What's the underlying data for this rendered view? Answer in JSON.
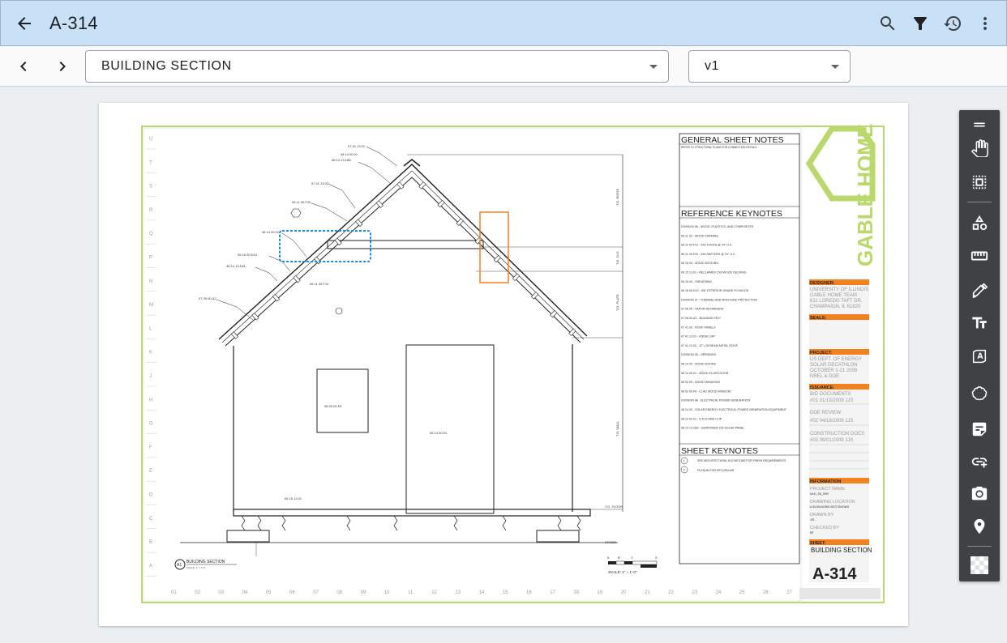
{
  "app": {
    "title": "A-314"
  },
  "toolbar_actions": [
    "search-icon",
    "filter-icon",
    "history-icon",
    "more-vert-icon"
  ],
  "sheet_select": {
    "value": "BUILDING SECTION"
  },
  "version_select": {
    "value": "v1"
  },
  "drawing": {
    "general_notes_title": "GENERAL SHEET NOTES",
    "general_note_1": "REFER TO STRUCTURAL PLANS FOR CONNECTION DETAILS",
    "reference_title": "REFERENCE KEYNOTES",
    "reference_lines": [
      "DIVISION 06 - WOOD, PLASTICS, AND COMPOSITES",
      "06 11 00 - WOOD FRAMING",
      "06 11 00.F13   -   2X6 JOISTS @ 24\" O.C.",
      "06 11 00.F20   -   2X6 RAFTERS @ 24\" O.C.",
      "06 15 00 - WOOD DECKING",
      "06 15 13.01   -   RECLAIMED 2X6 WOOD DECKING",
      "06 16 00 - SHEATHING",
      "06 16 00.D10   -   5/8\" EXTERIOR GRADE PLYWOOD",
      "DIVISION 07 - THERMAL AND MOISTURE PROTECTION",
      "07 26 00 - VAPOR RETARDERS",
      "07 26 00.A2   -   BUILDING FELT",
      "07 41 00 - ROOF PANELS",
      "07 41 13.01   -   RIDGE CAP",
      "07 41 13.02   -   12\" LOKSEAM METAL ROOF",
      "DIVISION 08 - OPENINGS",
      "08 14 00 - WOOD DOORS",
      "08 14 00.01   -   WOOD FLUSH DOOR",
      "08 52 00 - WOOD WINDOWS",
      "08 52 00.F8   -   CLAD WOOD WINDOW",
      "DIVISION 48 - ELECTRICAL POWER GENERATION",
      "48 14 00 - SOLAR ENERGY ELECTRICAL POWER GENERATION EQUIPMENT",
      "48 14 00.01   -   S-5! U-MINI CLIP",
      "48 14 13.16A   -   SUNPOWER 225 SOLAR PANEL"
    ],
    "sheet_keynotes_title": "SHEET KEYNOTES",
    "sheet_keynote_1": "SEE ARCHITECTURAL ELEVATIONS FOR FINISH REQUIREMENTS",
    "sheet_keynote_2": "PLENUM FOR RETURN AIR",
    "logo_text": "GABLE HOME",
    "designer_label": "DESIGNER:",
    "designer_lines": [
      "UNIVERSITY OF ILLINOIS",
      "GABLE HOME TEAM",
      "611 LOREDO TAFT DR.",
      "CHAMPAIGN, IL 61820"
    ],
    "seals_label": "SEALS:",
    "project_label": "PROJECT:",
    "project_lines": [
      "US DEPT. OF ENERGY",
      "SOLAR DECATHLON",
      "OCTOBER 1-21 2009",
      "NREL & DOE"
    ],
    "issuance_label": "ISSUANCE:",
    "issuance_1_title": "BID DOCUMENTS",
    "issuance_1_row": "#01  01/15/2009  JJS",
    "issuance_2_title": "DOE REVIEW",
    "issuance_2_row": "#02  04/16/2009  JJS",
    "issuance_3_title": "CONSTRUCTION DOCS",
    "issuance_3_row": "#03  06/01/2009  JJS",
    "information_label": "INFORMATION",
    "project_name_label": "PROJECT NAME",
    "project_name_value": "UIUC_SD_2009",
    "drawing_location_label": "DRAWING LOCATION",
    "drawing_location_value": "A-314 BUILDING SECTION.DWG",
    "drawn_by_label": "DRAWN BY",
    "drawn_by_value": "JJS",
    "checked_by_label": "CHECKED BY",
    "checked_by_value": "MT",
    "sheet_label": "SHEET:",
    "sheet_name": "BUILDING SECTION",
    "sheet_number": "A-314",
    "section_title": "BUILDING SECTION",
    "section_scale_small": "SCALE: 1\" = 1'-0\"",
    "scale_label": "SCALE: 1\" = 1'-0\"",
    "scale_ticks": [
      "0",
      "6\"",
      "1'",
      "2'"
    ],
    "row_labels": [
      "U",
      "T",
      "S",
      "R",
      "Q",
      "P",
      "N",
      "M",
      "L",
      "K",
      "J",
      "H",
      "G",
      "F",
      "E",
      "D",
      "C",
      "B",
      "A"
    ],
    "col_labels": [
      "01",
      "02",
      "03",
      "04",
      "05",
      "06",
      "07",
      "08",
      "09",
      "10",
      "11",
      "12",
      "13",
      "14",
      "15",
      "16",
      "17",
      "18",
      "19",
      "20",
      "21",
      "22",
      "23",
      "24",
      "25",
      "26",
      "27"
    ],
    "section_marker": "A1",
    "keynote_tag_1": "1",
    "keynote_tag_2": "2",
    "callouts": [
      "07 41 13.01",
      "48 14 00.01",
      "48 14 13.16A",
      "07 41 13.02",
      "06 11 00.F20",
      "48 14 00.01",
      "06 16 00.D10",
      "48 14 13.16A",
      "06 11 00.F13",
      "07 26 00.A2"
    ],
    "window_tag": "08 52 00.F8",
    "door_tag": "08 14 00.01",
    "floor_tag": "06 15 13.01",
    "level_marks": [
      "T.O. RIDGE",
      "T.O. CLG",
      "T.O. PLATE",
      "T.O. WALL",
      "T.O. FLOOR",
      "GRADE"
    ]
  },
  "right_tools": [
    "drag-handle-icon",
    "pan-hand-icon",
    "select-area-icon",
    "shapes-icon",
    "measure-ruler-icon",
    "markup-pen-icon",
    "text-icon",
    "text-box-icon",
    "cloud-icon",
    "note-icon",
    "add-link-icon",
    "camera-icon",
    "location-pin-icon",
    "fill-pattern-icon"
  ],
  "colors": {
    "appbar": "#c8e1f6",
    "accent_green": "#b9d96a",
    "markup_blue": "#1e88e5",
    "markup_orange": "#f4811f",
    "toolbar_bg": "#3f4245"
  }
}
